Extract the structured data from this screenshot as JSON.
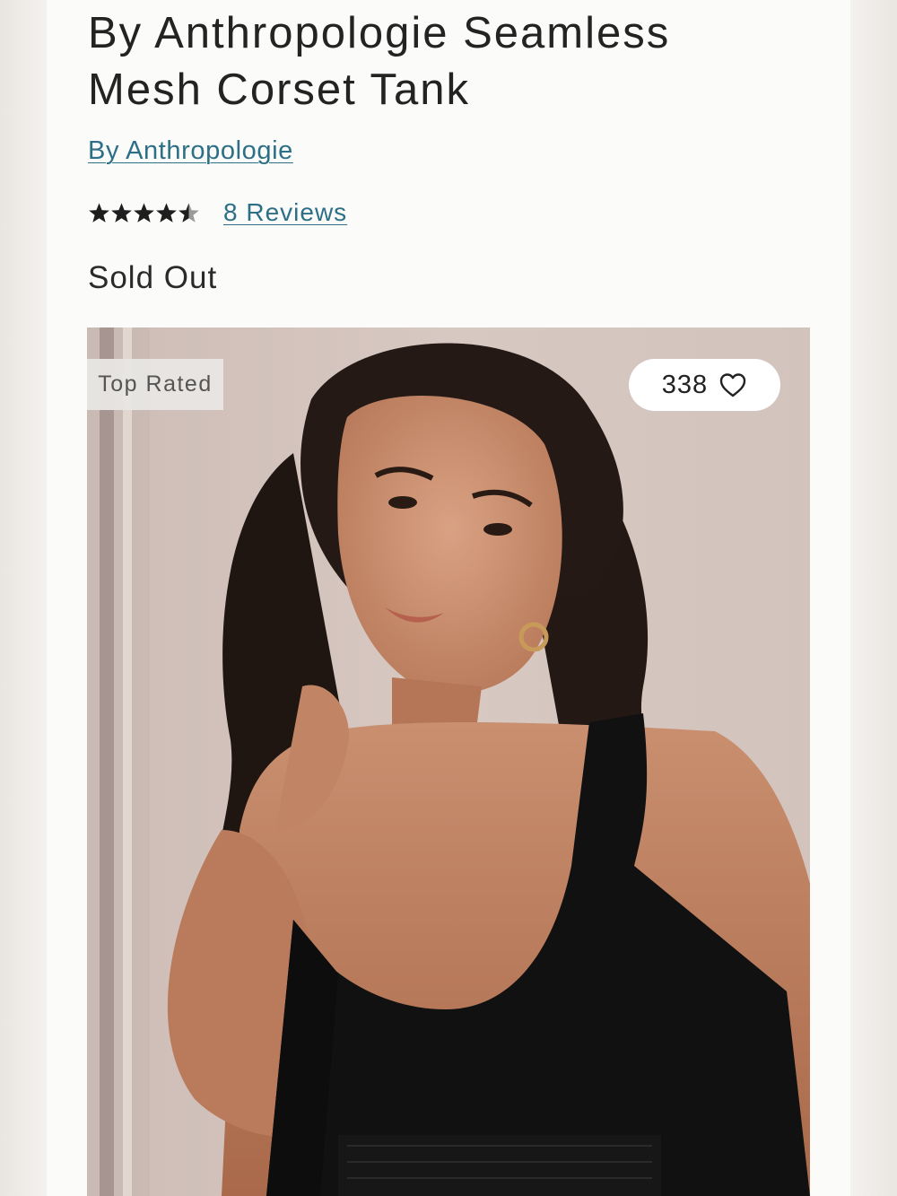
{
  "product": {
    "title": "By Anthropologie Seamless Mesh Corset Tank",
    "brand_link": "By Anthropologie",
    "rating": 4.5,
    "rating_max": 5,
    "reviews_link": "8 Reviews",
    "availability": "Sold Out"
  },
  "image": {
    "badge": "Top Rated",
    "favorite_count": "338",
    "favorite_icon": "heart-outline-icon"
  },
  "colors": {
    "link": "#2d6f86",
    "text": "#232323",
    "page_background": "#fbfbf9"
  }
}
